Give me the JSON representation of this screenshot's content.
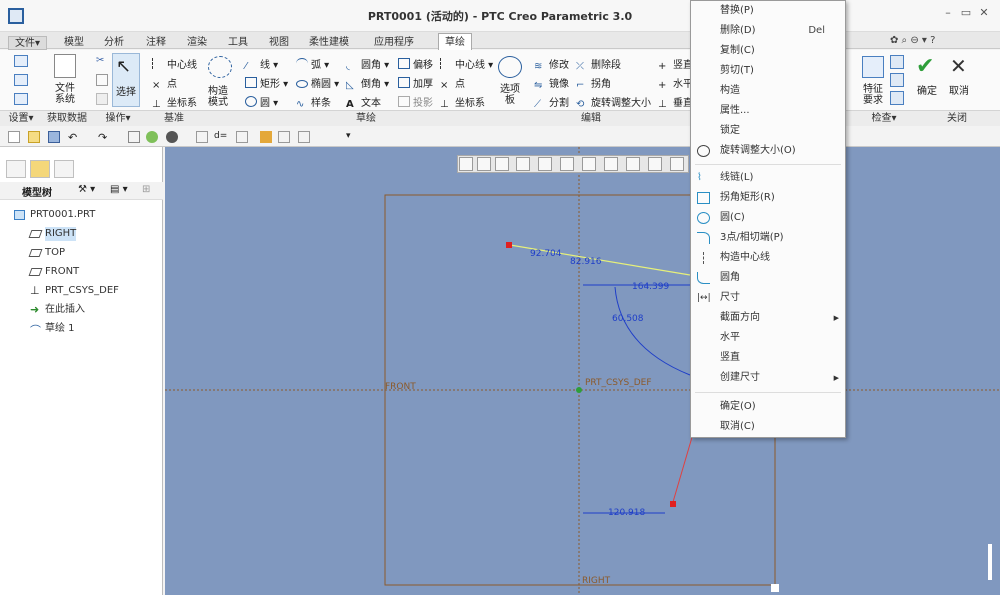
{
  "window": {
    "title": "PRT0001 (活动的) - PTC Creo Parametric 3.0"
  },
  "tabs": [
    {
      "label": "文件▾"
    },
    {
      "label": "模型"
    },
    {
      "label": "分析"
    },
    {
      "label": "注释"
    },
    {
      "label": "渲染"
    },
    {
      "label": "工具"
    },
    {
      "label": "视图"
    },
    {
      "label": "柔性建模"
    },
    {
      "label": "应用程序"
    },
    {
      "label": "草绘"
    }
  ],
  "ribbon": {
    "file_system": "文件\n系统",
    "select": "选择",
    "construction_mode": "构造\n模式",
    "centerline": "中心线",
    "point": "点",
    "coord_sys": "坐标系",
    "line": "线",
    "rectangle": "矩形",
    "circle": "圆",
    "arc": "弧",
    "ellipse": "椭圆",
    "spline": "样条",
    "fillet": "圆角",
    "chamfer": "倒角",
    "text": "文本",
    "offset": "偏移",
    "thicken": "加厚",
    "project": "投影",
    "centerline2": "中心线",
    "point2": "点",
    "coord_sys2": "坐标系",
    "palette": "选项\n板",
    "modify": "修改",
    "mirror": "镜像",
    "divide": "分割",
    "delete_segment": "删除段",
    "corner": "拐角",
    "rotate_resize": "旋转调整大小",
    "vertical": "竖直",
    "horizontal": "水平",
    "perpendicular": "垂直",
    "feature_req": "特征\n要求",
    "ok": "确定",
    "cancel": "取消",
    "groups": {
      "setup": "设置▾",
      "get_data": "获取数据",
      "operation": "操作▾",
      "datum": "基准",
      "sketch": "草绘",
      "edit": "编辑",
      "inspect": "检查▾",
      "close": "关闭"
    }
  },
  "model_tree": {
    "title": "模型树",
    "items": [
      {
        "label": "PRT0001.PRT"
      },
      {
        "label": "RIGHT"
      },
      {
        "label": "TOP"
      },
      {
        "label": "FRONT"
      },
      {
        "label": "PRT_CSYS_DEF"
      },
      {
        "label": "在此插入"
      },
      {
        "label": "草绘 1"
      }
    ]
  },
  "sketch": {
    "dims": [
      "92.704",
      "82.916",
      "164.399",
      "60.508",
      "120.918"
    ],
    "labels": {
      "front": "FRONT",
      "csys": "PRT_CSYS_DEF",
      "right": "RIGHT"
    }
  },
  "context_menu": {
    "items": [
      {
        "label": "替换(P)",
        "shortcut": ""
      },
      {
        "label": "删除(D)",
        "shortcut": "Del"
      },
      {
        "label": "复制(C)",
        "shortcut": ""
      },
      {
        "label": "剪切(T)",
        "shortcut": ""
      },
      {
        "label": "构造",
        "shortcut": ""
      },
      {
        "label": "属性...",
        "shortcut": ""
      },
      {
        "label": "锁定",
        "shortcut": ""
      },
      {
        "label": "旋转调整大小(O)",
        "shortcut": ""
      },
      {
        "label": "线链(L)",
        "shortcut": ""
      },
      {
        "label": "拐角矩形(R)",
        "shortcut": ""
      },
      {
        "label": "圆(C)",
        "shortcut": ""
      },
      {
        "label": "3点/相切端(P)",
        "shortcut": ""
      },
      {
        "label": "构造中心线",
        "shortcut": ""
      },
      {
        "label": "圆角",
        "shortcut": ""
      },
      {
        "label": "尺寸",
        "shortcut": ""
      },
      {
        "label": "截面方向",
        "shortcut": ""
      },
      {
        "label": "水平",
        "shortcut": ""
      },
      {
        "label": "竖直",
        "shortcut": ""
      },
      {
        "label": "创建尺寸",
        "shortcut": ""
      },
      {
        "label": "确定(O)",
        "shortcut": ""
      },
      {
        "label": "取消(C)",
        "shortcut": ""
      }
    ]
  },
  "colors": {
    "graphics_bg": "#8098bf",
    "selected_line": "#e6f07a",
    "dim_blue": "#1e3ec8",
    "datum_brown": "#8b5a2b",
    "accent_green": "#2e9e3a"
  }
}
